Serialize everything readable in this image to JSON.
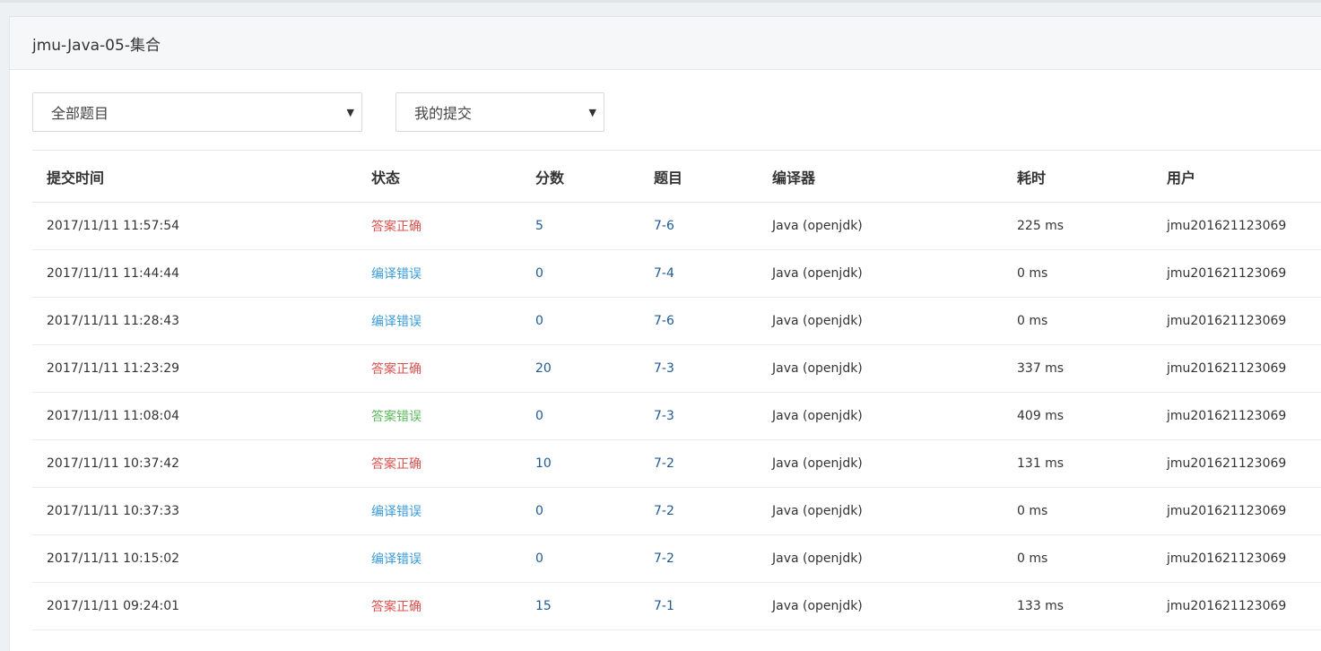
{
  "panel": {
    "title": "jmu-Java-05-集合"
  },
  "filters": {
    "problem_select": "全部题目",
    "scope_select": "我的提交"
  },
  "colors": {
    "accepted": "#d9534f",
    "compile_error": "#3a9bd8",
    "wrong_answer": "#5cb85c",
    "link": "#1f5a96"
  },
  "table": {
    "columns": [
      "提交时间",
      "状态",
      "分数",
      "题目",
      "编译器",
      "耗时",
      "用户"
    ],
    "rows": [
      {
        "time": "2017/11/11 11:57:54",
        "status": "答案正确",
        "status_type": "accepted",
        "score": "5",
        "problem": "7-6",
        "compiler": "Java (openjdk)",
        "elapsed": "225 ms",
        "user": "jmu201621123069"
      },
      {
        "time": "2017/11/11 11:44:44",
        "status": "编译错误",
        "status_type": "compile_error",
        "score": "0",
        "problem": "7-4",
        "compiler": "Java (openjdk)",
        "elapsed": "0 ms",
        "user": "jmu201621123069"
      },
      {
        "time": "2017/11/11 11:28:43",
        "status": "编译错误",
        "status_type": "compile_error",
        "score": "0",
        "problem": "7-6",
        "compiler": "Java (openjdk)",
        "elapsed": "0 ms",
        "user": "jmu201621123069"
      },
      {
        "time": "2017/11/11 11:23:29",
        "status": "答案正确",
        "status_type": "accepted",
        "score": "20",
        "problem": "7-3",
        "compiler": "Java (openjdk)",
        "elapsed": "337 ms",
        "user": "jmu201621123069"
      },
      {
        "time": "2017/11/11 11:08:04",
        "status": "答案错误",
        "status_type": "wrong_answer",
        "score": "0",
        "problem": "7-3",
        "compiler": "Java (openjdk)",
        "elapsed": "409 ms",
        "user": "jmu201621123069"
      },
      {
        "time": "2017/11/11 10:37:42",
        "status": "答案正确",
        "status_type": "accepted",
        "score": "10",
        "problem": "7-2",
        "compiler": "Java (openjdk)",
        "elapsed": "131 ms",
        "user": "jmu201621123069"
      },
      {
        "time": "2017/11/11 10:37:33",
        "status": "编译错误",
        "status_type": "compile_error",
        "score": "0",
        "problem": "7-2",
        "compiler": "Java (openjdk)",
        "elapsed": "0 ms",
        "user": "jmu201621123069"
      },
      {
        "time": "2017/11/11 10:15:02",
        "status": "编译错误",
        "status_type": "compile_error",
        "score": "0",
        "problem": "7-2",
        "compiler": "Java (openjdk)",
        "elapsed": "0 ms",
        "user": "jmu201621123069"
      },
      {
        "time": "2017/11/11 09:24:01",
        "status": "答案正确",
        "status_type": "accepted",
        "score": "15",
        "problem": "7-1",
        "compiler": "Java (openjdk)",
        "elapsed": "133 ms",
        "user": "jmu201621123069"
      }
    ]
  }
}
